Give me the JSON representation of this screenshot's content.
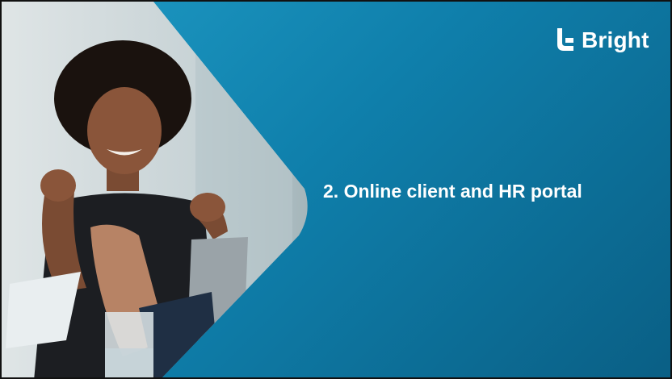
{
  "slide": {
    "brand": {
      "name": "Bright",
      "icon": "bright-logo-icon"
    },
    "title": "2. Online client and HR portal",
    "colors": {
      "background_start": "#1f9bc5",
      "background_end": "#0a5f85",
      "text": "#ffffff"
    },
    "image": {
      "name": "meeting-photo"
    }
  }
}
